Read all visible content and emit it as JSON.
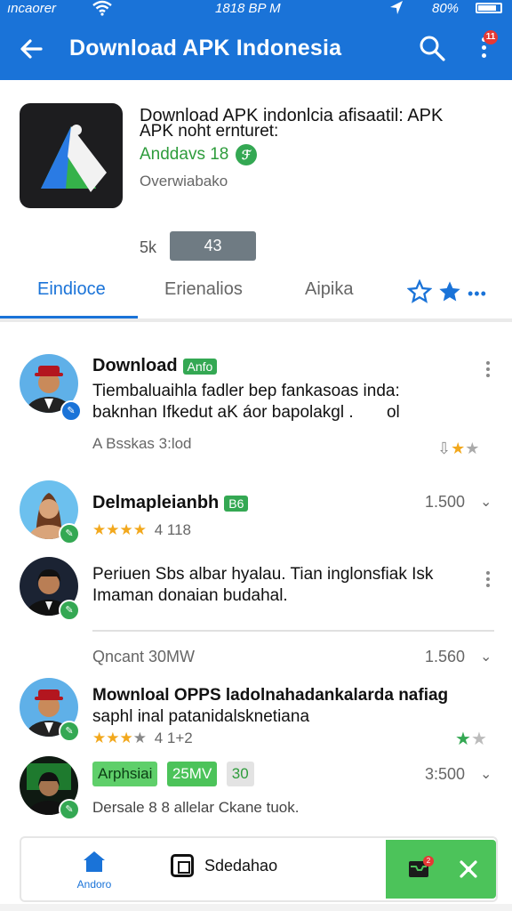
{
  "status_bar": {
    "carrier": "ıncaorer",
    "time": "1818 BP M",
    "battery": "80%"
  },
  "app_bar": {
    "title": "Download APK Indonesia",
    "notification_count": "11"
  },
  "app": {
    "title_line1": "Download APK indonlcia afisaatil: APK",
    "title_line2": "APK noht ernturet:",
    "developer": "Anddavs 18",
    "subtitle": "Overwiabako",
    "stat_label": "5k",
    "stat_value": "43"
  },
  "tabs": [
    {
      "label": "Eindioce",
      "active": true
    },
    {
      "label": "Erienalios",
      "active": false
    },
    {
      "label": "Aipika",
      "active": false
    }
  ],
  "items": [
    {
      "name": "Download",
      "badge": "Anfo",
      "desc_line1": "Tiembaluaihla fadler bep fankasoas inda:",
      "desc_line2": "baknhan Ifkedut aK áor bapolakgl .",
      "desc_tail": "ol",
      "meta": "A Bsskas 3:lod"
    },
    {
      "name": "Delmapleianbh",
      "badge": "B6",
      "stars_text": "★★★★",
      "rating": "4 118",
      "right_value": "1.500"
    },
    {
      "name": "",
      "desc_line1": "Periuen Sbs albar hyalau. Tian inglonsfiak Isk",
      "desc_line2": "Imaman donaian budahal."
    },
    {
      "meta": "Qncant 30MW",
      "right_value": "1.560"
    },
    {
      "desc_line1": "Mownloal OPPS ladolnahadankalarda nafiag",
      "desc_line2": "saphl inal patanidalsknetiana",
      "rating": "4 1+2"
    },
    {
      "pill1": "Arphsiai",
      "pill2": "25MV",
      "pill3": "30",
      "right_value": "3:500",
      "meta": "Dersale 8 8 allelar Ckane tuok."
    }
  ],
  "bottom_nav": {
    "home_label": "Andoro",
    "center_label": "Sdedahao",
    "badge_count": "2"
  },
  "colors": {
    "primary": "#1a73d8",
    "green": "#34a853",
    "star": "#f2a81d"
  }
}
